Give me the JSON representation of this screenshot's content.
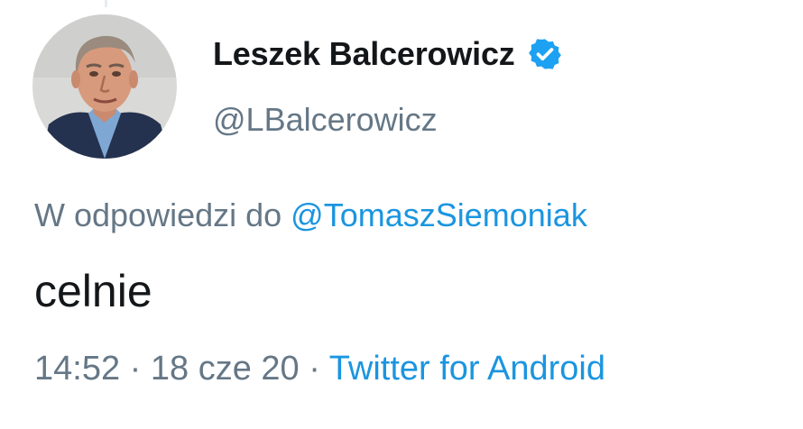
{
  "author": {
    "display_name": "Leszek Balcerowicz",
    "handle": "@LBalcerowicz",
    "verified_icon": "verified-badge-icon",
    "avatar": "profile-photo"
  },
  "reply": {
    "prefix": "W odpowiedzi do",
    "mention": "@TomaszSiemoniak"
  },
  "tweet": {
    "text": "celnie"
  },
  "meta": {
    "time": "14:52",
    "separator": "·",
    "date": "18 cze 20",
    "source": "Twitter for Android"
  },
  "colors": {
    "name_text": "#14171a",
    "secondary_text": "#657786",
    "link": "#1b95e0",
    "verified": "#1da1f2"
  }
}
